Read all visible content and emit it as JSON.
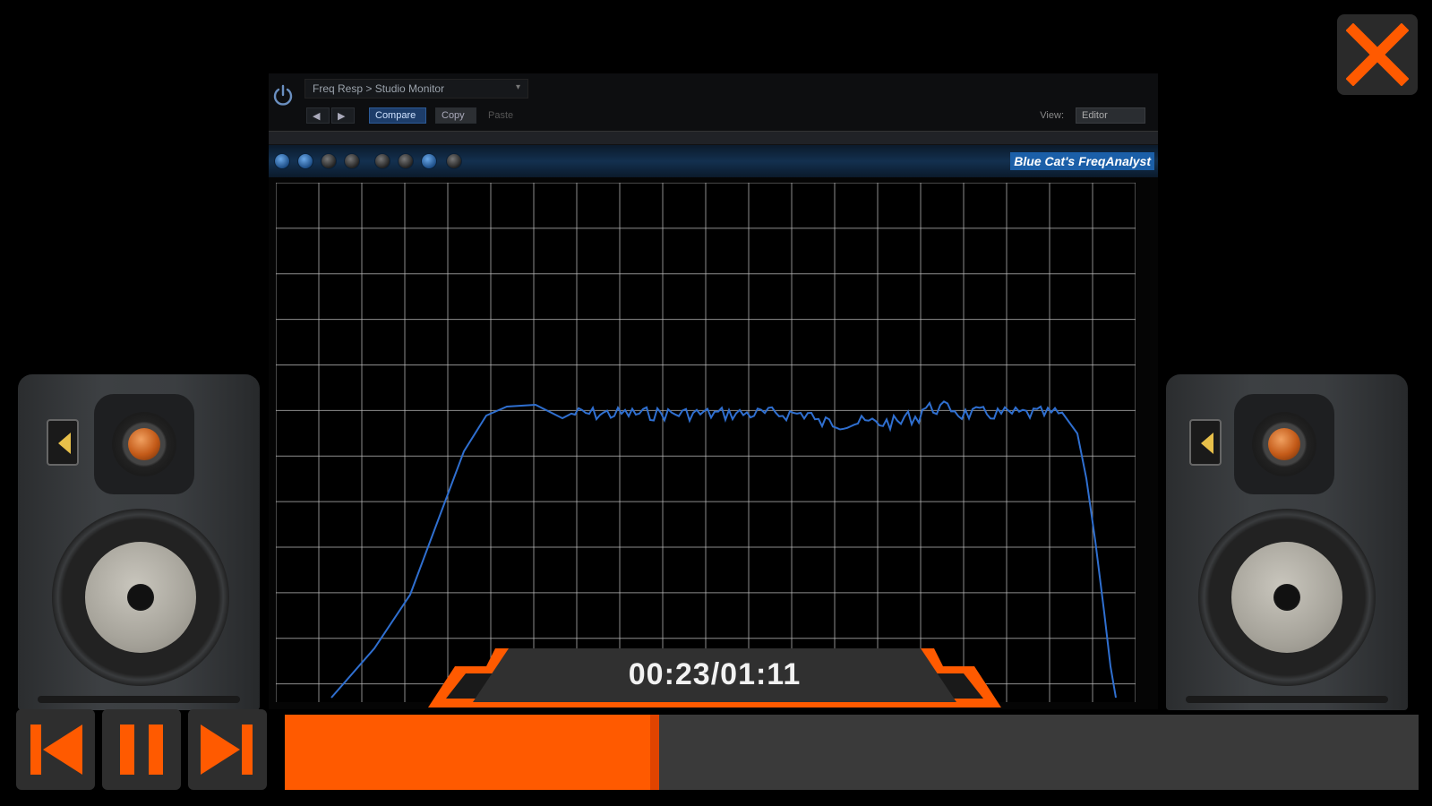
{
  "plugin": {
    "preset_label": "Freq Resp > Studio Monitor",
    "buttons": {
      "compare": "Compare",
      "copy": "Copy",
      "paste": "Paste"
    },
    "view_label": "View:",
    "view_value": "Editor",
    "brand": "Blue Cat's FreqAnalyst"
  },
  "player": {
    "time_display": "00:23/01:11",
    "progress_fraction": 0.33
  },
  "colors": {
    "accent": "#ff5a00",
    "curve": "#2f6fd0",
    "grid": "#bcbcbc"
  },
  "icons": {
    "close": "close-icon",
    "power": "power-icon",
    "prev": "skip-previous-icon",
    "pause": "pause-icon",
    "next": "skip-next-icon"
  }
}
